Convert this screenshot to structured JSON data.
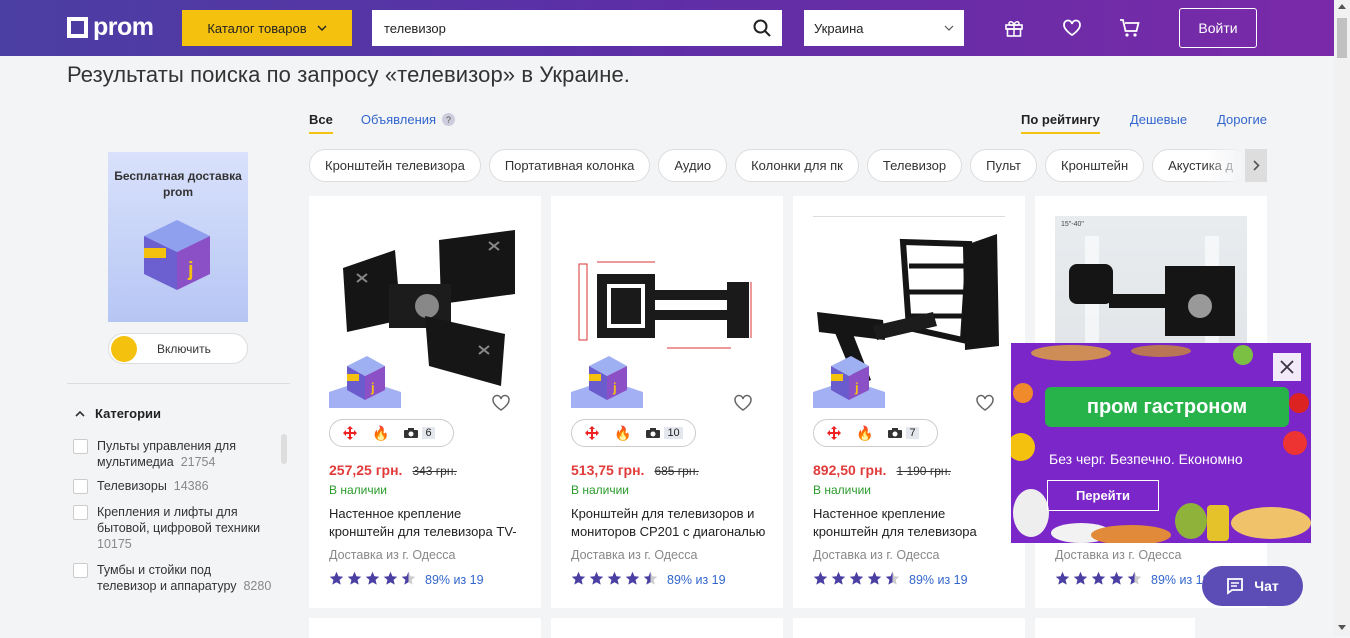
{
  "header": {
    "logo_text": "prom",
    "catalog_label": "Каталог товаров",
    "search_value": "телевизор",
    "region_value": "Украина",
    "login_label": "Войти",
    "icons": [
      "gift-icon",
      "heart-icon",
      "cart-icon"
    ]
  },
  "page": {
    "title": "Результаты поиска по запросу «телевизор» в Украине."
  },
  "tabs": {
    "all": "Все",
    "ads": "Объявления",
    "ads_help": "?"
  },
  "sort": {
    "rating": "По рейтингу",
    "cheap": "Дешевые",
    "expensive": "Дорогие"
  },
  "chips": [
    "Кронштейн телевизора",
    "Портативная колонка",
    "Аудио",
    "Колонки для пк",
    "Телевизор",
    "Пульт",
    "Кронштейн",
    "Акустика д"
  ],
  "sidebar": {
    "promo_text": "Бесплатная доставка prom",
    "enable_label": "Включить",
    "categories_title": "Категории",
    "categories": [
      {
        "label": "Пульты управления для мультимедиа",
        "count": "21754"
      },
      {
        "label": "Телевизоры",
        "count": "14386"
      },
      {
        "label": "Крепления и лифты для бытовой, цифровой техники",
        "count": "10175"
      },
      {
        "label": "Тумбы и стойки под телевизор и аппаратуру",
        "count": "8280"
      }
    ]
  },
  "products": [
    {
      "photos": "6",
      "price": "257,25 грн.",
      "old_price": "343 грн.",
      "availability": "В наличии",
      "name": "Настенное крепление кронштейн для телевизора TV-",
      "delivery": "Доставка из г. Одесса",
      "rating": "89% из 19",
      "stars": 4.5
    },
    {
      "photos": "10",
      "price": "513,75 грн.",
      "old_price": "685 грн.",
      "availability": "В наличии",
      "name": "Кронштейн для телевизоров и мониторов CP201 с диагональю",
      "delivery": "Доставка из г. Одесса",
      "rating": "89% из 19",
      "stars": 4.5
    },
    {
      "photos": "7",
      "price": "892,50 грн.",
      "old_price": "1 190 грн.",
      "availability": "В наличии",
      "name": "Настенное крепление кронштейн для телевизора",
      "delivery": "Доставка из г. Одесса",
      "rating": "89% из 19",
      "stars": 4.5
    },
    {
      "photos": "",
      "price": "",
      "old_price": "",
      "availability": "",
      "name": "",
      "delivery": "Доставка из г. Одесса",
      "rating": "89% из 19",
      "stars": 4.5
    }
  ],
  "ad": {
    "title": "пром гастроном",
    "tagline": "Без черг. Безпечно. Економно",
    "button": "Перейти"
  },
  "chat": {
    "label": "Чат"
  },
  "colors": {
    "accent": "#f5c10f",
    "header": "#5c2fa6",
    "price": "#e13b3b",
    "link": "#3366cc",
    "available": "#2b9b2b",
    "star": "#4b3fa3"
  }
}
